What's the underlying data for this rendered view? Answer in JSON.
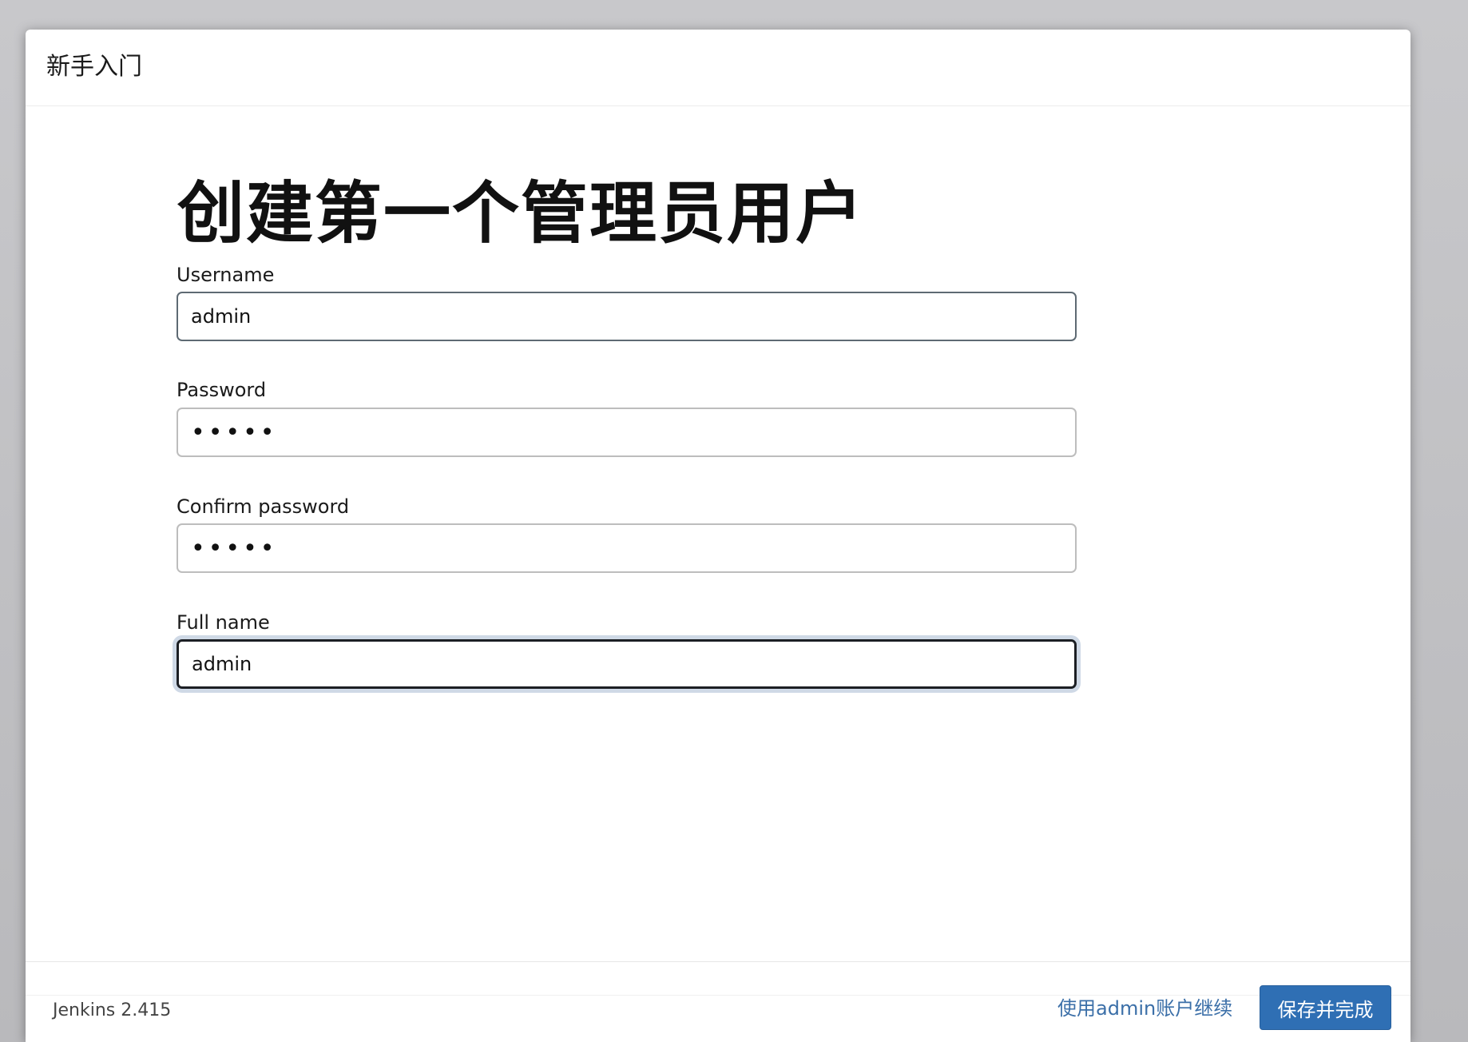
{
  "dialog": {
    "title": "新手入门"
  },
  "main": {
    "heading": "创建第一个管理员用户",
    "fields": [
      {
        "label": "Username",
        "value": "admin"
      },
      {
        "label": "Password",
        "value": "•••••"
      },
      {
        "label": "Confirm password",
        "value": "•••••"
      },
      {
        "label": "Full name",
        "value": "admin"
      }
    ]
  },
  "footer": {
    "version": "Jenkins 2.415",
    "continue_link": "使用admin账户继续",
    "save_button": "保存并完成"
  },
  "colors": {
    "primary_button": "#2f6fb4",
    "link": "#3b6fa8",
    "focus_ring": "#cfd9e6"
  }
}
